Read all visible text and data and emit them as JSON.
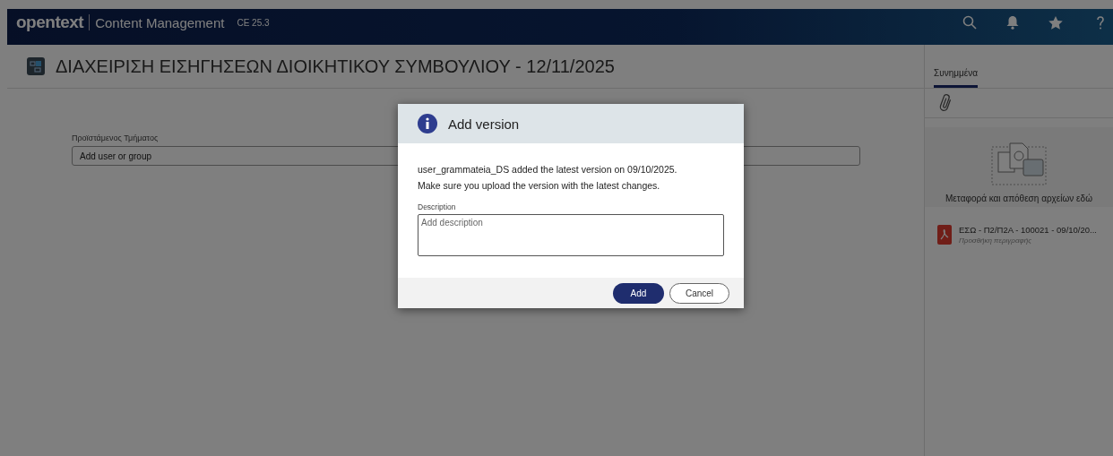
{
  "header": {
    "brand": "opentext",
    "product": "Content Management",
    "version": "CE 25.3"
  },
  "page": {
    "title": "ΔΙΑΧΕΙΡΙΣΗ ΕΙΣΗΓΗΣΕΩΝ ΔΙΟΙΚΗΤΙΚΟΥ ΣΥΜΒΟΥΛΙΟΥ - 12/11/2025",
    "field": {
      "label": "Προϊστάμενος Τμήματος",
      "placeholder": "Add user or group"
    }
  },
  "side_panel": {
    "tabs": [
      {
        "label": "Συνημμένα",
        "selected": true
      }
    ],
    "dropzone_text": "Μεταφορά και απόθεση αρχείων εδώ",
    "files": [
      {
        "name": "ΕΣΩ - Π2/Π2Α - 100021 - 09/10/20...",
        "description": "Προσθήκη περιγραφής"
      }
    ]
  },
  "dialog": {
    "title": "Add version",
    "message": "user_grammateia_DS added the latest version on 09/10/2025.",
    "message_2": "Make sure you upload the version with the latest changes.",
    "field": {
      "label": "Description",
      "placeholder": "Add description"
    },
    "buttons": [
      {
        "label": "Add",
        "kind": "primary"
      },
      {
        "label": "Cancel",
        "kind": "secondary"
      }
    ]
  }
}
